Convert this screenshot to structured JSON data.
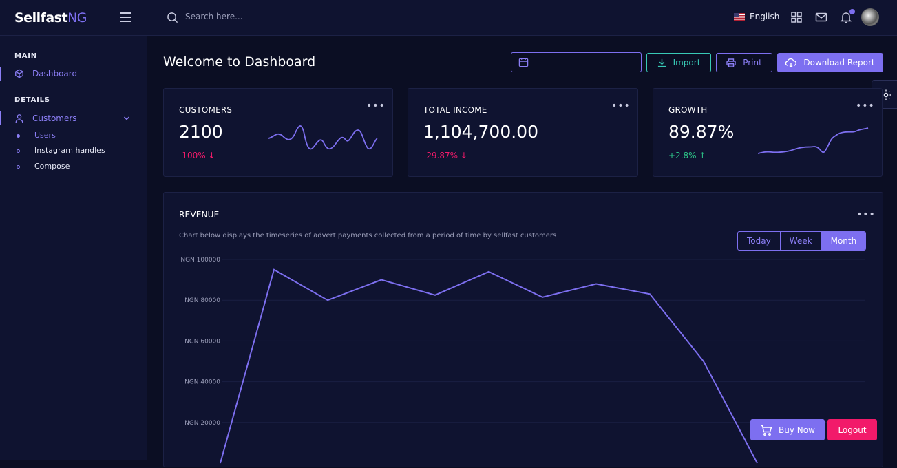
{
  "brand": {
    "name": "Sellfast",
    "suffix": "NG"
  },
  "sidebar": {
    "main_label": "MAIN",
    "details_label": "DETAILS",
    "dashboard": "Dashboard",
    "customers": "Customers",
    "sub_items": [
      "Users",
      "Instagram handles",
      "Compose"
    ]
  },
  "topbar": {
    "search_placeholder": "Search here...",
    "language": "English"
  },
  "page": {
    "title": "Welcome to Dashboard",
    "import": "Import",
    "print": "Print",
    "download": "Download Report"
  },
  "cards": [
    {
      "label": "CUSTOMERS",
      "value": "2100",
      "change": "-100% ↓",
      "trend": "down"
    },
    {
      "label": "TOTAL INCOME",
      "value": "1,104,700.00",
      "change": "-29.87% ↓",
      "trend": "down"
    },
    {
      "label": "GROWTH",
      "value": "89.87%",
      "change": "+2.8% ↑",
      "trend": "up"
    }
  ],
  "revenue": {
    "title": "REVENUE",
    "description": "Chart below displays the timeseries of advert payments collected from a period of time by sellfast customers",
    "ranges": [
      "Today",
      "Week",
      "Month"
    ],
    "active_range": "Month"
  },
  "chart_data": {
    "type": "line",
    "y_ticks": [
      "NGN 100000",
      "NGN 80000",
      "NGN 60000",
      "NGN 40000",
      "NGN 20000"
    ],
    "ylim": [
      0,
      100000
    ],
    "values": [
      0,
      95000,
      80000,
      90000,
      82500,
      94000,
      81500,
      88000,
      83000,
      50000,
      0
    ],
    "grid": true
  },
  "actions": {
    "buy": "Buy Now",
    "logout": "Logout"
  },
  "colors": {
    "accent": "#7d6ff0",
    "teal": "#38c9b6",
    "negative": "#f21a6a",
    "positive": "#2ec98a"
  }
}
